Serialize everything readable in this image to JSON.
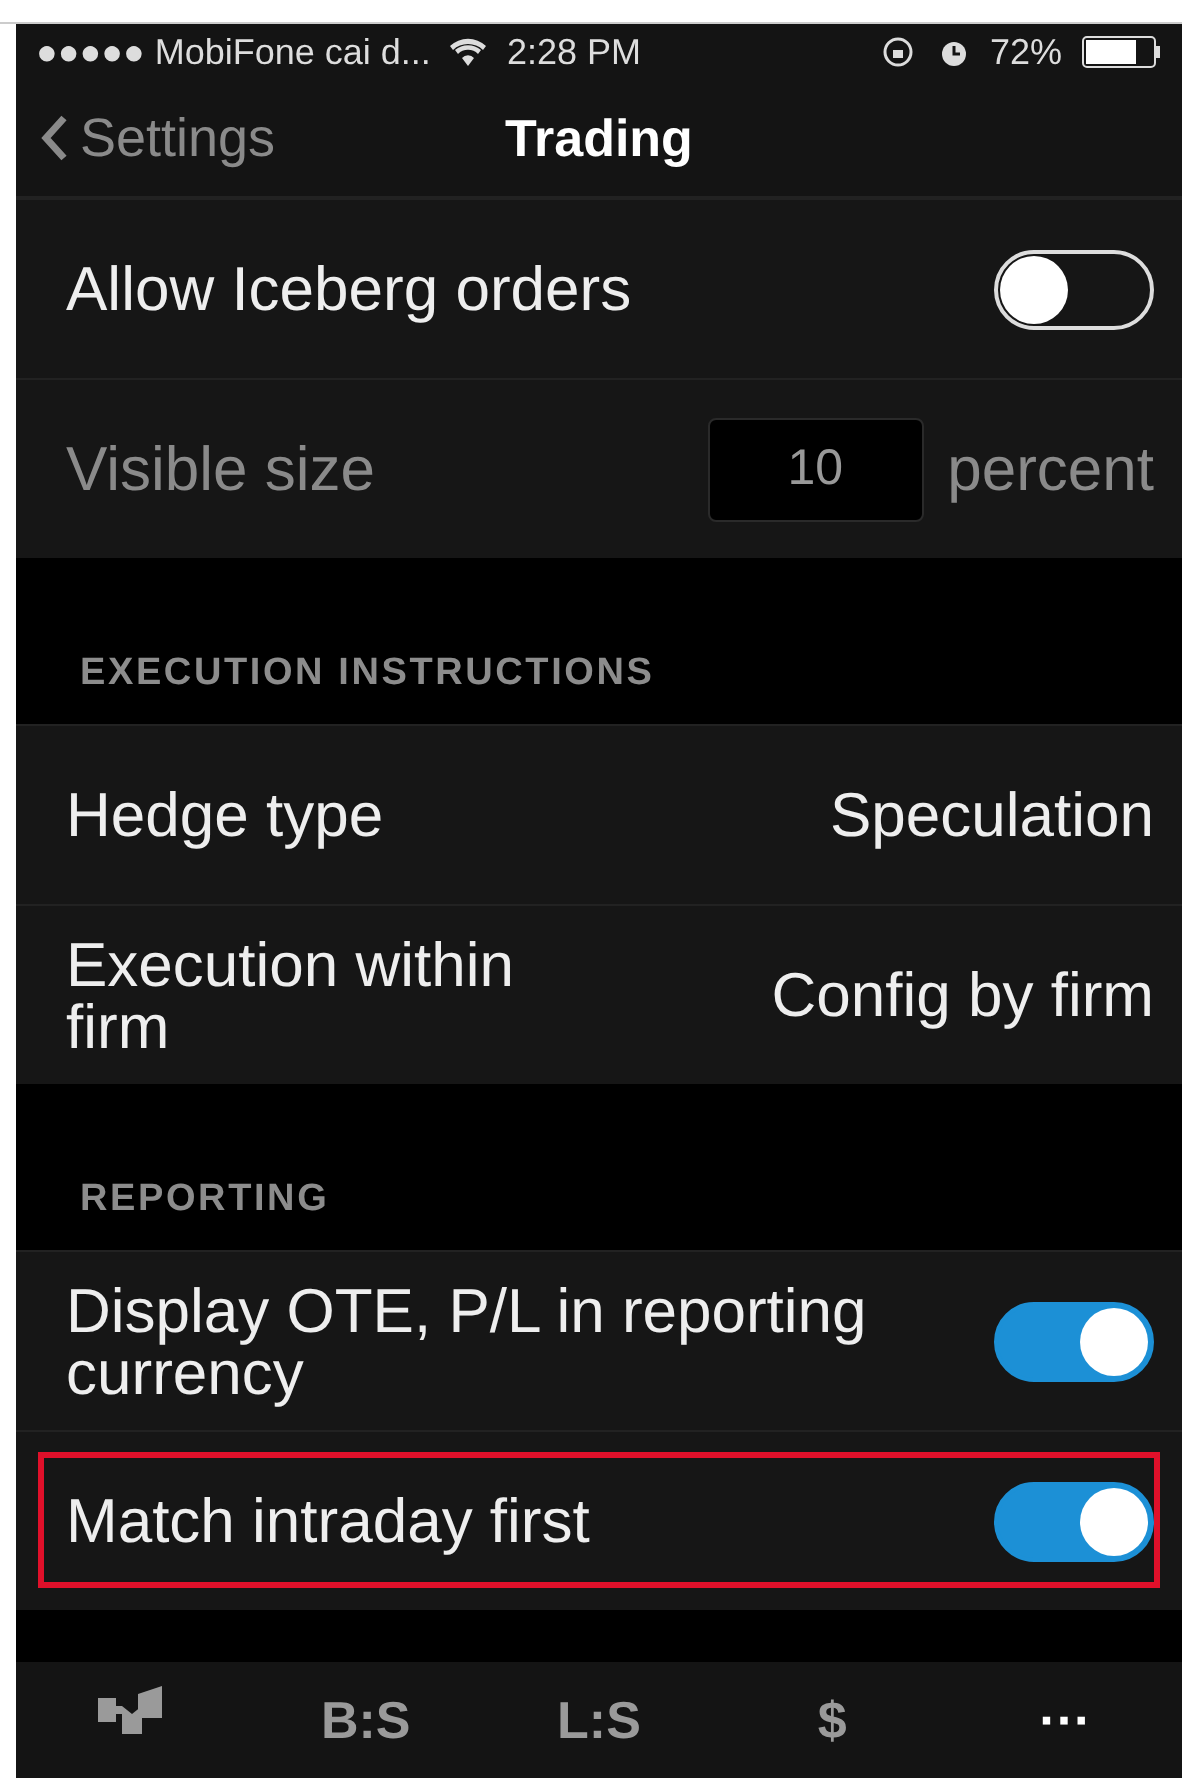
{
  "status_bar": {
    "carrier": "●●●●● MobiFone cai d...",
    "time": "2:28 PM",
    "battery": "72%"
  },
  "nav": {
    "back": "Settings",
    "title": "Trading"
  },
  "sections": [
    {
      "rows": [
        {
          "kind": "toggle",
          "label": "Allow Iceberg orders",
          "on": false,
          "highlighted": false
        },
        {
          "kind": "input",
          "label": "Visible size",
          "value": "10",
          "unit": "percent",
          "disabled": true,
          "highlighted": false
        }
      ]
    },
    {
      "header": "EXECUTION INSTRUCTIONS",
      "rows": [
        {
          "kind": "value",
          "label": "Hedge type",
          "value": "Speculation",
          "highlighted": false
        },
        {
          "kind": "value",
          "label": "Execution within firm",
          "value": "Config by firm",
          "highlighted": false
        }
      ]
    },
    {
      "header": "REPORTING",
      "rows": [
        {
          "kind": "toggle",
          "label": "Display OTE, P/L in reporting currency",
          "on": true,
          "highlighted": false
        },
        {
          "kind": "toggle",
          "label": "Match intraday first",
          "on": true,
          "highlighted": true
        }
      ]
    }
  ],
  "tab_bar": [
    {
      "kind": "logo"
    },
    {
      "kind": "text",
      "label": "B:S"
    },
    {
      "kind": "text",
      "label": "L:S"
    },
    {
      "kind": "text",
      "label": "$"
    },
    {
      "kind": "text",
      "label": "···"
    }
  ]
}
